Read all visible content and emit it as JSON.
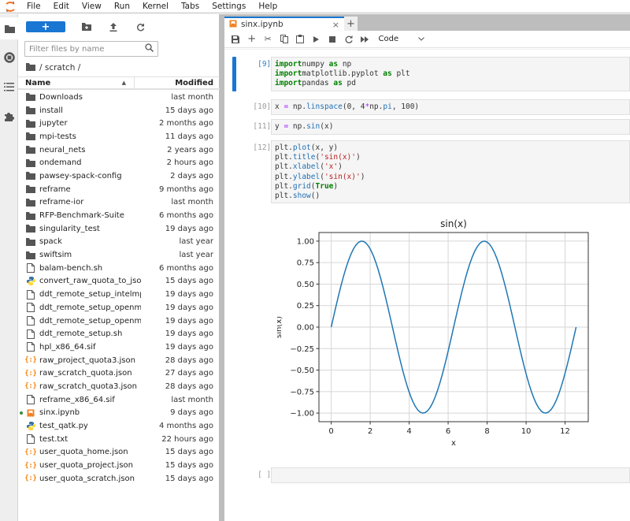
{
  "menubar": {
    "items": [
      "File",
      "Edit",
      "View",
      "Run",
      "Kernel",
      "Tabs",
      "Settings",
      "Help"
    ]
  },
  "left_sidebar": {
    "icons": [
      "folder-icon",
      "running-icon",
      "toc-icon",
      "extension-icon"
    ]
  },
  "file_browser": {
    "new_button_label": "+",
    "filter_placeholder": "Filter files by name",
    "breadcrumb": "/ scratch /",
    "columns": {
      "name": "Name",
      "modified": "Modified"
    },
    "files": [
      {
        "name": "Downloads",
        "modified": "last month",
        "type": "folder"
      },
      {
        "name": "install",
        "modified": "15 days ago",
        "type": "folder"
      },
      {
        "name": "jupyter",
        "modified": "2 months ago",
        "type": "folder"
      },
      {
        "name": "mpi-tests",
        "modified": "11 days ago",
        "type": "folder"
      },
      {
        "name": "neural_nets",
        "modified": "2 years ago",
        "type": "folder"
      },
      {
        "name": "ondemand",
        "modified": "2 hours ago",
        "type": "folder"
      },
      {
        "name": "pawsey-spack-config",
        "modified": "2 days ago",
        "type": "folder"
      },
      {
        "name": "reframe",
        "modified": "9 months ago",
        "type": "folder"
      },
      {
        "name": "reframe-ior",
        "modified": "last month",
        "type": "folder"
      },
      {
        "name": "RFP-Benchmark-Suite",
        "modified": "6 months ago",
        "type": "folder"
      },
      {
        "name": "singularity_test",
        "modified": "19 days ago",
        "type": "folder"
      },
      {
        "name": "spack",
        "modified": "last year",
        "type": "folder"
      },
      {
        "name": "swiftsim",
        "modified": "last year",
        "type": "folder"
      },
      {
        "name": "balam-bench.sh",
        "modified": "6 months ago",
        "type": "file"
      },
      {
        "name": "convert_raw_quota_to_jso...",
        "modified": "15 days ago",
        "type": "python"
      },
      {
        "name": "ddt_remote_setup_intelmp...",
        "modified": "19 days ago",
        "type": "file"
      },
      {
        "name": "ddt_remote_setup_openm...",
        "modified": "19 days ago",
        "type": "file"
      },
      {
        "name": "ddt_remote_setup_openm...",
        "modified": "19 days ago",
        "type": "file"
      },
      {
        "name": "ddt_remote_setup.sh",
        "modified": "19 days ago",
        "type": "file"
      },
      {
        "name": "hpl_x86_64.sif",
        "modified": "19 days ago",
        "type": "file"
      },
      {
        "name": "raw_project_quota3.json",
        "modified": "28 days ago",
        "type": "json"
      },
      {
        "name": "raw_scratch_quota.json",
        "modified": "27 days ago",
        "type": "json"
      },
      {
        "name": "raw_scratch_quota3.json",
        "modified": "28 days ago",
        "type": "json"
      },
      {
        "name": "reframe_x86_64.sif",
        "modified": "last month",
        "type": "file"
      },
      {
        "name": "sinx.ipynb",
        "modified": "9 days ago",
        "type": "notebook",
        "running": true
      },
      {
        "name": "test_qatk.py",
        "modified": "4 months ago",
        "type": "python"
      },
      {
        "name": "test.txt",
        "modified": "22 hours ago",
        "type": "file"
      },
      {
        "name": "user_quota_home.json",
        "modified": "15 days ago",
        "type": "json"
      },
      {
        "name": "user_quota_project.json",
        "modified": "15 days ago",
        "type": "json"
      },
      {
        "name": "user_quota_scratch.json",
        "modified": "15 days ago",
        "type": "json"
      }
    ]
  },
  "notebook": {
    "tab_title": "sinx.ipynb",
    "tab_close": "×",
    "tab_add": "+",
    "cell_type": "Code",
    "cells": [
      {
        "prompt": "[9]:",
        "lines": [
          [
            [
              "kw",
              "import"
            ],
            [
              "",
              "numpy "
            ],
            [
              "kw",
              "as"
            ],
            [
              "",
              " np"
            ]
          ],
          [
            [
              "kw",
              "import"
            ],
            [
              "",
              "matplotlib.pyplot "
            ],
            [
              "kw",
              "as"
            ],
            [
              "",
              " plt"
            ]
          ],
          [
            [
              "kw",
              "import"
            ],
            [
              "",
              "pandas "
            ],
            [
              "kw",
              "as"
            ],
            [
              "",
              " pd"
            ]
          ]
        ]
      },
      {
        "prompt": "[10]:",
        "lines": [
          [
            [
              "",
              "x "
            ],
            [
              "op",
              "="
            ],
            [
              "",
              " np."
            ],
            [
              "fn",
              "linspace"
            ],
            [
              "",
              "(0, 4"
            ],
            [
              "op",
              "*"
            ],
            [
              "",
              "np."
            ],
            [
              "fn",
              "pi"
            ],
            [
              "",
              ", 100)"
            ]
          ]
        ]
      },
      {
        "prompt": "[11]:",
        "lines": [
          [
            [
              "",
              "y "
            ],
            [
              "op",
              "="
            ],
            [
              "",
              " np."
            ],
            [
              "fn",
              "sin"
            ],
            [
              "",
              "(x)"
            ]
          ]
        ]
      },
      {
        "prompt": "[12]:",
        "lines": [
          [
            [
              "",
              "plt."
            ],
            [
              "fn",
              "plot"
            ],
            [
              "",
              "(x, y)"
            ]
          ],
          [
            [
              "",
              "plt."
            ],
            [
              "fn",
              "title"
            ],
            [
              "",
              "("
            ],
            [
              "st",
              "'sin(x)'"
            ],
            [
              "",
              ")"
            ]
          ],
          [
            [
              "",
              "plt."
            ],
            [
              "fn",
              "xlabel"
            ],
            [
              "",
              "("
            ],
            [
              "st",
              "'x'"
            ],
            [
              "",
              ")"
            ]
          ],
          [
            [
              "",
              "plt."
            ],
            [
              "fn",
              "ylabel"
            ],
            [
              "",
              "("
            ],
            [
              "st",
              "'sin(x)'"
            ],
            [
              "",
              ")"
            ]
          ],
          [
            [
              "",
              "plt."
            ],
            [
              "fn",
              "grid"
            ],
            [
              "",
              "("
            ],
            [
              "kw",
              "True"
            ],
            [
              "",
              ")"
            ]
          ],
          [
            [
              "",
              "plt."
            ],
            [
              "fn",
              "show"
            ],
            [
              "",
              "()"
            ]
          ]
        ]
      },
      {
        "prompt": "[ ]:",
        "lines": [
          [
            [
              "",
              ""
            ]
          ]
        ]
      }
    ]
  },
  "chart_data": {
    "type": "line",
    "title": "sin(x)",
    "xlabel": "x",
    "ylabel": "sin(x)",
    "function": "y = sin(x), x = linspace(0, 4*pi, 100)",
    "x_range": [
      0,
      12.566
    ],
    "n_points": 100,
    "xlim": [
      -0.63,
      13.19
    ],
    "ylim": [
      -1.1,
      1.1
    ],
    "xticks": [
      0,
      2,
      4,
      6,
      8,
      10,
      12
    ],
    "yticks": [
      -1.0,
      -0.75,
      -0.5,
      -0.25,
      0.0,
      0.25,
      0.5,
      0.75,
      1.0
    ],
    "ytick_labels": [
      "−1.00",
      "−0.75",
      "−0.50",
      "−0.25",
      "0.00",
      "0.25",
      "0.50",
      "0.75",
      "1.00"
    ],
    "grid": true,
    "line_color": "#1f77b4",
    "series": [
      {
        "name": "sin(x)",
        "x_start": 0,
        "x_end": 12.566,
        "count": 100
      }
    ]
  },
  "colors": {
    "accent": "#1976d2",
    "running_dot": "#388e3c",
    "json_icon": "#f57c00",
    "notebook_icon": "#ef6c00"
  }
}
